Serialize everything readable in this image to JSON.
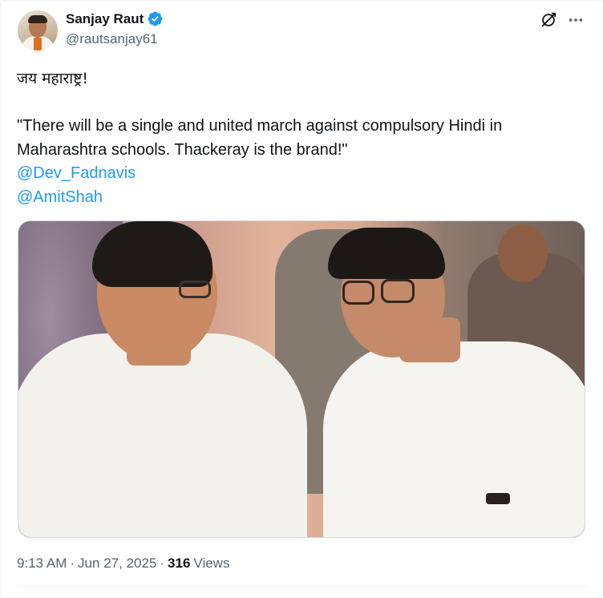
{
  "author": {
    "display_name": "Sanjay Raut",
    "handle": "@rautsanjay61",
    "verified_icon": "verified-badge-icon",
    "verified_color": "#1d9bf0"
  },
  "header_actions": {
    "grok_icon": "grok-icon",
    "more_icon": "more-icon"
  },
  "tweet": {
    "line1": "जय महाराष्ट्र!",
    "line2": "\"There will be a single and united march against compulsory Hindi in",
    "line3": "Maharashtra schools. Thackeray is the brand!\"",
    "mentions": [
      "@Dev_Fadnavis",
      "@AmitShah"
    ],
    "mention_color": "#1d9bf0"
  },
  "media": {
    "type": "photo"
  },
  "meta": {
    "time": "9:13 AM",
    "separator": "·",
    "date": "Jun 27, 2025",
    "views_count": "316",
    "views_label": "Views"
  }
}
